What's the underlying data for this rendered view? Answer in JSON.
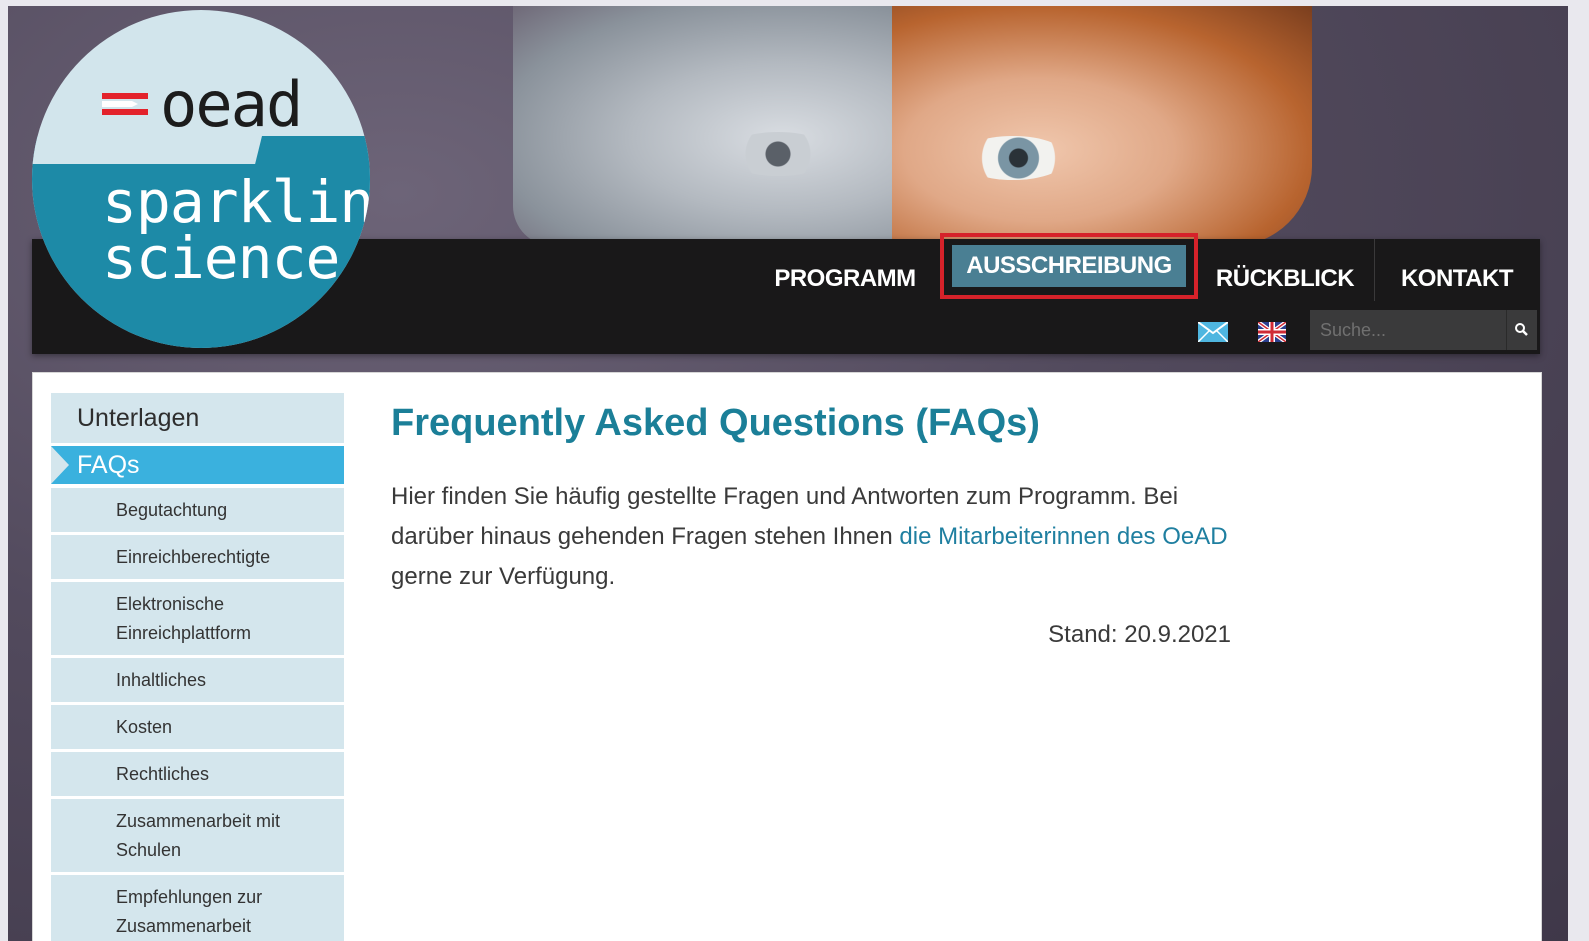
{
  "logo": {
    "brand": "oead",
    "line1": "sparkling",
    "line2": "science"
  },
  "nav": {
    "items": [
      "PROGRAMM",
      "AUSSCHREIBUNG",
      "RÜCKBLICK",
      "KONTAKT"
    ],
    "active": "AUSSCHREIBUNG",
    "search_placeholder": "Suche...",
    "icons": [
      "mail-icon",
      "uk-flag-icon",
      "search-icon"
    ]
  },
  "sidebar": {
    "header": "Unterlagen",
    "active": "FAQs",
    "items": [
      "Begutachtung",
      "Einreichberechtigte",
      "Elektronische Einreichplattform",
      "Inhaltliches",
      "Kosten",
      "Rechtliches",
      "Zusammenarbeit mit Schulen",
      "Empfehlungen zur Zusammenarbeit"
    ]
  },
  "main": {
    "title": "Frequently Asked Questions (FAQs)",
    "intro_before": "Hier finden Sie häufig gestellte Fragen und Antworten zum Programm. Bei darüber hinaus gehenden Fragen stehen Ihnen ",
    "intro_link": "die Mitarbeiterinnen des OeAD",
    "intro_after": " gerne zur Verfügung.",
    "stand": "Stand: 20.9.2021"
  },
  "colors": {
    "accent_red": "#d6222a",
    "active_nav": "#4a7f93",
    "sidebar_active": "#3ab1de",
    "sidebar_bg": "#d4e6ed",
    "title": "#1b7f98"
  }
}
